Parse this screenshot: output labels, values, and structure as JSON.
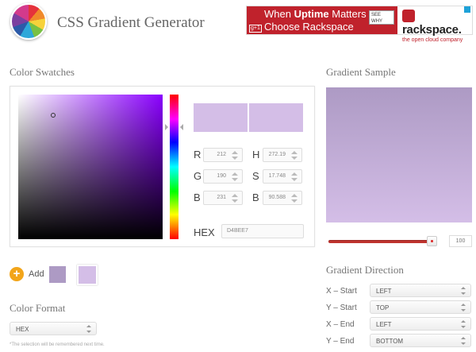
{
  "header": {
    "title": "CSS Gradient Generator",
    "ad": {
      "line1_prefix": "When ",
      "line1_bold": "Uptime",
      "line1_suffix": " Matters",
      "line2": "Choose Rackspace",
      "see_why": "SEE WHY",
      "plus": "g+1",
      "brand": "rackspace.",
      "tagline": "the open cloud company"
    }
  },
  "swatches": {
    "title": "Color Swatches",
    "rgb": {
      "r_label": "R",
      "g_label": "G",
      "b_label": "B",
      "r": "212",
      "g": "190",
      "b": "231"
    },
    "hsb": {
      "h_label": "H",
      "s_label": "S",
      "b_label": "B",
      "h": "272.19",
      "s": "17.748",
      "b": "90.588"
    },
    "hex_label": "HEX",
    "hex": "D4BEE7",
    "colors": {
      "selected": "#d4bee7",
      "other": "#ad9ac4"
    }
  },
  "add": {
    "label": "Add",
    "icon": "+"
  },
  "format": {
    "title": "Color Format",
    "selected": "HEX",
    "note": "*The selection will be remembered next time."
  },
  "sample": {
    "title": "Gradient Sample",
    "position_value": "100",
    "position_fraction": 0.95
  },
  "direction": {
    "title": "Gradient Direction",
    "rows": [
      {
        "label": "X – Start",
        "value": "LEFT"
      },
      {
        "label": "Y – Start",
        "value": "TOP"
      },
      {
        "label": "X – End",
        "value": "LEFT"
      },
      {
        "label": "Y – End",
        "value": "BOTTOM"
      }
    ]
  }
}
